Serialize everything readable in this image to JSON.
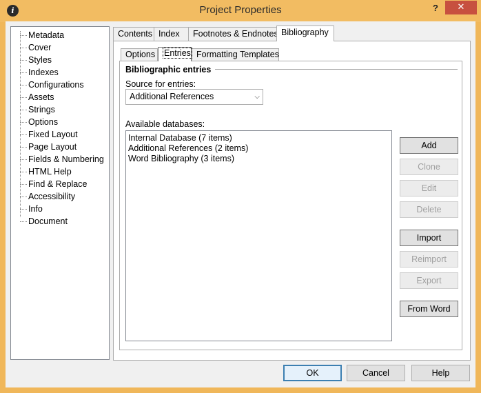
{
  "window": {
    "title": "Project Properties",
    "help_glyph": "?",
    "close_glyph": "✕",
    "app_icon_glyph": "i"
  },
  "tree": {
    "items": [
      "Metadata",
      "Cover",
      "Styles",
      "Indexes",
      "Configurations",
      "Assets",
      "Strings",
      "Options",
      "Fixed Layout",
      "Page Layout",
      "Fields & Numbering",
      "HTML Help",
      "Find & Replace",
      "Accessibility",
      "Info",
      "Document"
    ]
  },
  "outer_tabs": [
    "Contents",
    "Index",
    "Footnotes & Endnotes",
    "Bibliography"
  ],
  "inner_tabs": [
    "Options",
    "Entries",
    "Formatting Templates"
  ],
  "entries": {
    "group_title": "Bibliographic entries",
    "source_label": "Source for entries:",
    "source_value": "Additional References",
    "databases_label": "Available databases:",
    "databases": [
      "Internal Database (7 items)",
      "Additional References (2 items)",
      "Word Bibliography (3 items)"
    ]
  },
  "side_buttons": {
    "add": "Add",
    "clone": "Clone",
    "edit": "Edit",
    "delete": "Delete",
    "import": "Import",
    "reimport": "Reimport",
    "export": "Export",
    "from_word": "From Word"
  },
  "footer": {
    "ok": "OK",
    "cancel": "Cancel",
    "help": "Help"
  },
  "colors": {
    "title_bar": "#f2bc62",
    "close_button": "#c7503f",
    "default_button_border": "#3c7fb1"
  }
}
